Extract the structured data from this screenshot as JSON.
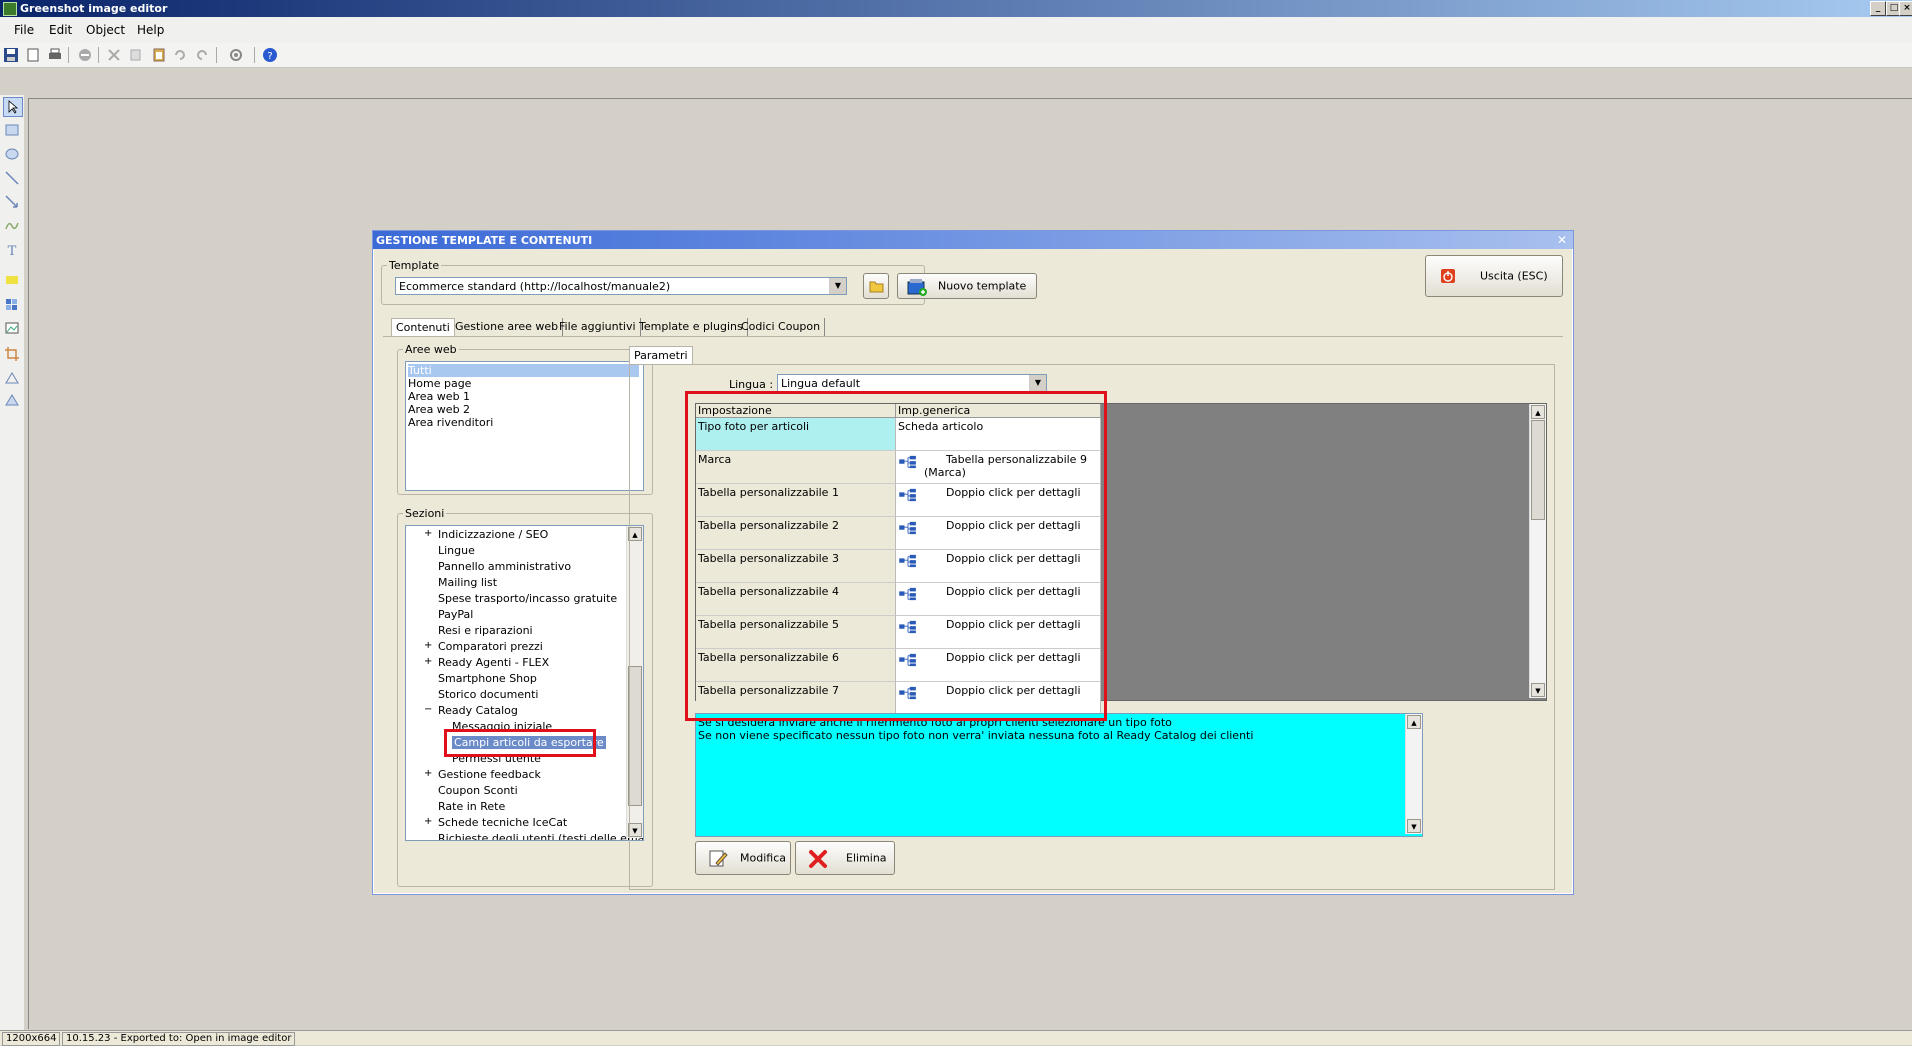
{
  "window": {
    "title": "Greenshot image editor"
  },
  "menu": [
    "File",
    "Edit",
    "Object",
    "Help"
  ],
  "dialog": {
    "title": "GESTIONE TEMPLATE E CONTENUTI",
    "template_group": "Template",
    "template_value": "Ecommerce standard (http://localhost/manuale2)",
    "new_template_label": "Nuovo template",
    "exit_label": "Uscita (ESC)",
    "tabs": [
      "Contenuti",
      "Gestione aree web",
      "File aggiuntivi",
      "Template e plugins",
      "Codici Coupon"
    ],
    "aree_web_label": "Aree web",
    "aree_web": [
      "Tutti",
      "Home page",
      "Area web 1",
      "Area web 2",
      "Area rivenditori"
    ],
    "sezioni_label": "Sezioni",
    "sezioni": [
      {
        "text": "Indicizzazione / SEO",
        "exp": "+",
        "level": 0
      },
      {
        "text": "Lingue",
        "exp": "",
        "level": 0
      },
      {
        "text": "Pannello amministrativo",
        "exp": "",
        "level": 0
      },
      {
        "text": "Mailing list",
        "exp": "",
        "level": 0
      },
      {
        "text": "Spese trasporto/incasso gratuite",
        "exp": "",
        "level": 0
      },
      {
        "text": "PayPal",
        "exp": "",
        "level": 0
      },
      {
        "text": "Resi e riparazioni",
        "exp": "",
        "level": 0
      },
      {
        "text": "Comparatori prezzi",
        "exp": "+",
        "level": 0
      },
      {
        "text": "Ready Agenti - FLEX",
        "exp": "+",
        "level": 0
      },
      {
        "text": "Smartphone Shop",
        "exp": "",
        "level": 0
      },
      {
        "text": "Storico documenti",
        "exp": "",
        "level": 0
      },
      {
        "text": "Ready Catalog",
        "exp": "−",
        "level": 0
      },
      {
        "text": "Messaggio iniziale",
        "exp": "",
        "level": 1
      },
      {
        "text": "Campi articoli da esportare",
        "exp": "",
        "level": 1
      },
      {
        "text": "Permessi utente",
        "exp": "",
        "level": 1
      },
      {
        "text": "Gestione feedback",
        "exp": "+",
        "level": 0
      },
      {
        "text": "Coupon Sconti",
        "exp": "",
        "level": 0
      },
      {
        "text": "Rate in Rete",
        "exp": "",
        "level": 0
      },
      {
        "text": "Schede tecniche IceCat",
        "exp": "+",
        "level": 0
      },
      {
        "text": "Richieste degli utenti (testi delle email)",
        "exp": "",
        "level": 0
      }
    ],
    "parametri_tab": "Parametri",
    "lingua_label": "Lingua :",
    "lingua_value": "Lingua default",
    "grid_headers": [
      "Impostazione",
      "Imp.generica"
    ],
    "grid_rows": [
      {
        "name": "Tipo foto per articoli",
        "value": "Scheda articolo",
        "value2": "",
        "icon": false
      },
      {
        "name": "Marca",
        "value": "Tabella personalizzabile 9",
        "value2": "(Marca)",
        "icon": true
      },
      {
        "name": "Tabella personalizzabile 1",
        "value": "Doppio click per dettagli",
        "value2": "",
        "icon": true
      },
      {
        "name": "Tabella personalizzabile 2",
        "value": "Doppio click per dettagli",
        "value2": "",
        "icon": true
      },
      {
        "name": "Tabella personalizzabile 3",
        "value": "Doppio click per dettagli",
        "value2": "",
        "icon": true
      },
      {
        "name": "Tabella personalizzabile 4",
        "value": "Doppio click per dettagli",
        "value2": "",
        "icon": true
      },
      {
        "name": "Tabella personalizzabile 5",
        "value": "Doppio click per dettagli",
        "value2": "",
        "icon": true
      },
      {
        "name": "Tabella personalizzabile 6",
        "value": "Doppio click per dettagli",
        "value2": "",
        "icon": true
      },
      {
        "name": "Tabella personalizzabile 7",
        "value": "Doppio click per dettagli",
        "value2": "",
        "icon": true
      }
    ],
    "description_lines": [
      "Se si desidera inviare anche il riferimento foto ai propri clienti selezionare un tipo foto",
      "Se non viene specificato nessun tipo foto non verra' inviata nessuna foto al Ready Catalog dei clienti"
    ],
    "modifica_label": "Modifica",
    "elimina_label": "Elimina"
  },
  "status": [
    "1200x664",
    "10.15.23 - Exported to: Open in image editor"
  ],
  "colors": {
    "highlight": "#e0101a",
    "description_bg": "#00ffff",
    "selected_cell": "#aef0f0"
  }
}
